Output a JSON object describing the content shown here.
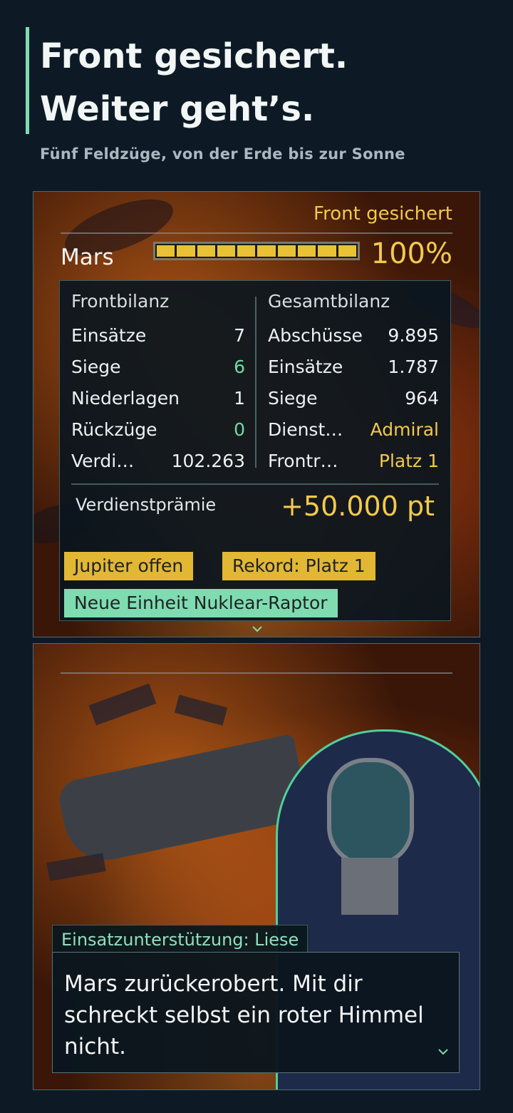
{
  "headline": {
    "line1": "Front gesichert.",
    "line2": "Weiter geht’s.",
    "subtitle": "Fünf Feldzüge, von der Erde bis zur Sonne"
  },
  "result": {
    "status": "Front gesichert",
    "planet": "Mars",
    "progress_percent_value": 100,
    "progress_label": "100%",
    "front_stats": {
      "heading": "Frontbilanz",
      "rows": [
        {
          "label": "Einsätze",
          "value": "7"
        },
        {
          "label": "Siege",
          "value": "6"
        },
        {
          "label": "Niederlagen",
          "value": "1"
        },
        {
          "label": "Rückzüge",
          "value": "0"
        },
        {
          "label": "Verdi…",
          "value": "102.263"
        }
      ]
    },
    "total_stats": {
      "heading": "Gesamtbilanz",
      "rows": [
        {
          "label": "Abschüsse",
          "value": "9.895"
        },
        {
          "label": "Einsätze",
          "value": "1.787"
        },
        {
          "label": "Siege",
          "value": "964"
        },
        {
          "label": "Dienst…",
          "value": "Admiral"
        },
        {
          "label": "Frontr…",
          "value": "Platz 1"
        }
      ]
    },
    "bonus_label": "Verdienstprämie",
    "bonus_value": "+50.000 pt",
    "tags": [
      "Jupiter offen",
      "Rekord: Platz 1",
      "Neue Einheit Nuklear-Raptor"
    ],
    "more_icon": "chevron-down-icon",
    "colors": {
      "gold": "#f2c94c",
      "green": "#7fdcb0",
      "panel": "#0a161e"
    }
  },
  "dialogue": {
    "speaker": "Einsatzunterstützung: Liese",
    "text": "Mars zurückerobert. Mit dir schreckt selbst ein roter Himmel nicht.",
    "continue_icon": "chevron-down-icon"
  }
}
